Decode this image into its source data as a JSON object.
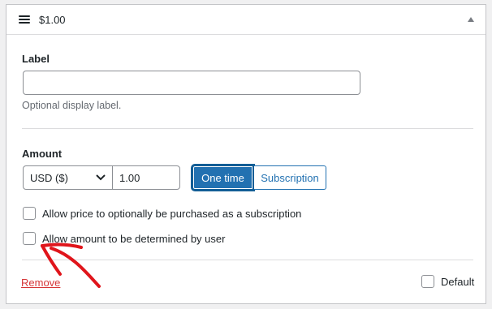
{
  "header": {
    "title": "$1.00"
  },
  "label_field": {
    "label": "Label",
    "value": "",
    "placeholder": "",
    "help": "Optional display label."
  },
  "amount_field": {
    "label": "Amount",
    "currency_selected": "USD ($)",
    "amount_value": "1.00",
    "type_options": [
      "One time",
      "Subscription"
    ],
    "type_selected": "One time"
  },
  "options": {
    "subscription_option": "Allow price to optionally be purchased as a subscription",
    "user_amount_option": "Allow amount to be determined by user"
  },
  "footer": {
    "remove_label": "Remove",
    "default_label": "Default"
  },
  "colors": {
    "primary": "#2271b1",
    "danger": "#d63638",
    "annotation": "#e0151b"
  },
  "icons": {
    "drag": "menu-icon",
    "collapse": "triangle-up-icon",
    "select": "chevron-down-icon",
    "annotation": "red-arrow"
  }
}
